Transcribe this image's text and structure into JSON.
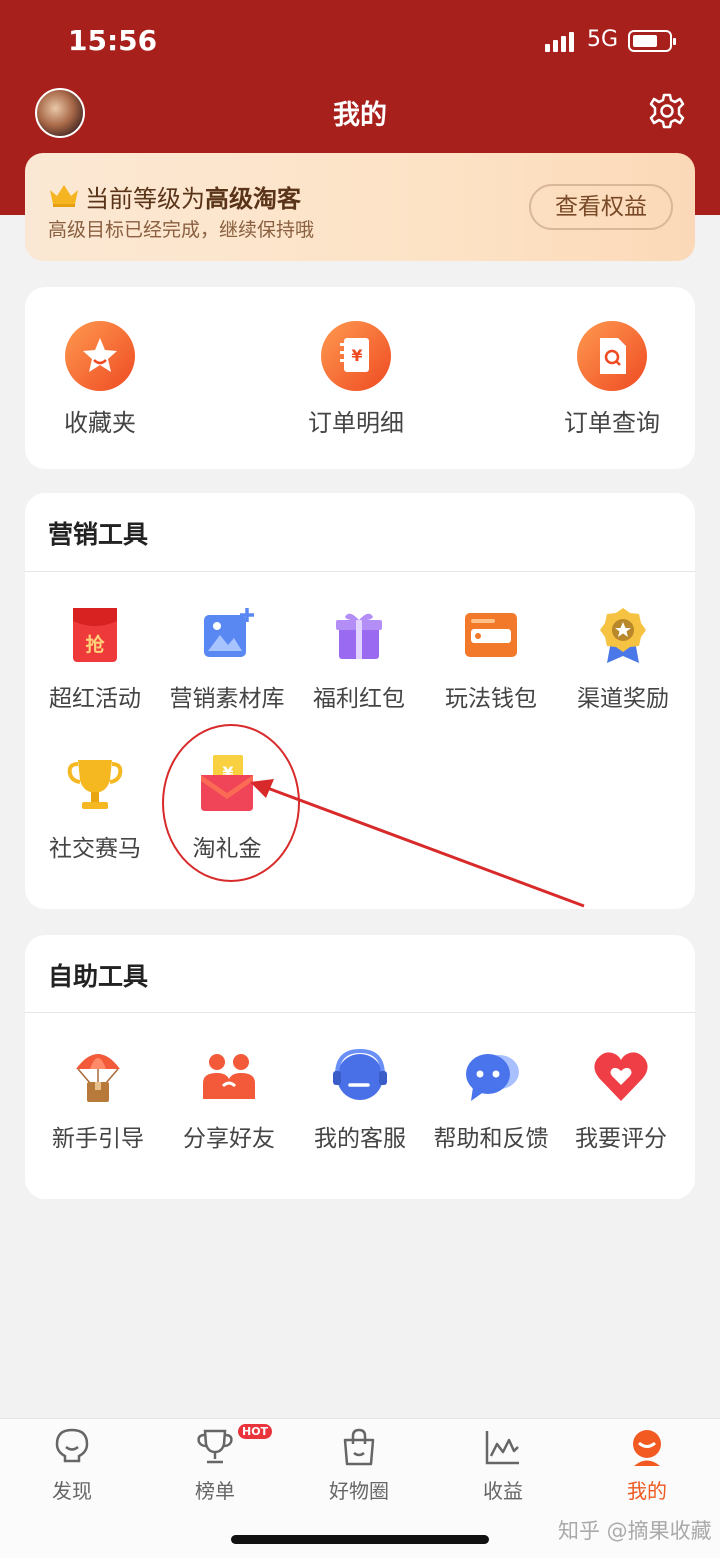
{
  "status_bar": {
    "time": "15:56",
    "network": "5G"
  },
  "header": {
    "title": "我的"
  },
  "level_card": {
    "prefix": "当前等级为",
    "level": "高级淘客",
    "subtitle": "高级目标已经完成，继续保持哦",
    "button": "查看权益"
  },
  "quick_links": [
    {
      "label": "收藏夹",
      "icon": "star-face-icon"
    },
    {
      "label": "订单明细",
      "icon": "order-book-icon"
    },
    {
      "label": "订单查询",
      "icon": "order-search-icon"
    }
  ],
  "marketing": {
    "title": "营销工具",
    "items": [
      {
        "label": "超红活动",
        "icon": "red-envelope-grab-icon"
      },
      {
        "label": "营销素材库",
        "icon": "image-add-icon"
      },
      {
        "label": "福利红包",
        "icon": "gift-box-icon"
      },
      {
        "label": "玩法钱包",
        "icon": "wallet-icon"
      },
      {
        "label": "渠道奖励",
        "icon": "medal-icon"
      },
      {
        "label": "社交赛马",
        "icon": "trophy-icon"
      },
      {
        "label": "淘礼金",
        "icon": "yuan-envelope-icon"
      }
    ]
  },
  "self_service": {
    "title": "自助工具",
    "items": [
      {
        "label": "新手引导",
        "icon": "parachute-box-icon"
      },
      {
        "label": "分享好友",
        "icon": "friends-icon"
      },
      {
        "label": "我的客服",
        "icon": "headset-icon"
      },
      {
        "label": "帮助和反馈",
        "icon": "chat-bubble-icon"
      },
      {
        "label": "我要评分",
        "icon": "heart-icon"
      }
    ]
  },
  "tabbar": {
    "items": [
      {
        "label": "发现",
        "icon": "bulb-icon"
      },
      {
        "label": "榜单",
        "icon": "trophy-icon",
        "badge": "HOT"
      },
      {
        "label": "好物圈",
        "icon": "shopping-bag-icon"
      },
      {
        "label": "收益",
        "icon": "chart-line-icon"
      },
      {
        "label": "我的",
        "icon": "profile-face-icon",
        "active": true
      }
    ]
  },
  "watermark": "知乎 @摘果收藏",
  "colors": {
    "header": "#a8201c",
    "accent": "#ee5a20",
    "annotation": "#d82a2a"
  }
}
